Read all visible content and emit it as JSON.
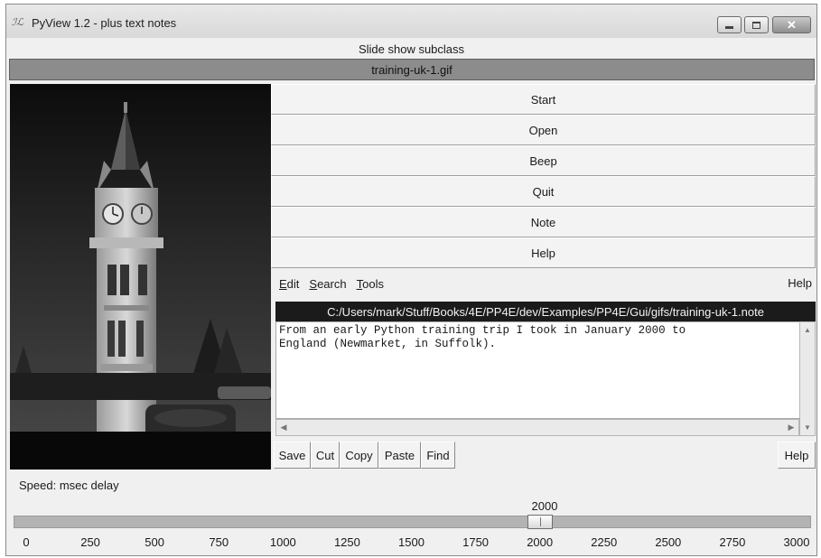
{
  "window": {
    "title": "PyView 1.2 - plus text notes",
    "icon": "tk-feather-icon",
    "controls": {
      "minimize": "minimize-icon",
      "maximize": "maximize-icon",
      "close": "close-icon"
    }
  },
  "header": {
    "subclass_label": "Slide show subclass",
    "image_name": "training-uk-1.gif"
  },
  "photo": {
    "subject": "clock-tower-photo"
  },
  "buttons": [
    {
      "label": "Start"
    },
    {
      "label": "Open"
    },
    {
      "label": "Beep"
    },
    {
      "label": "Quit"
    },
    {
      "label": "Note"
    },
    {
      "label": "Help"
    }
  ],
  "editor": {
    "menu": [
      {
        "label": "Edit",
        "mnemonic": "E",
        "rest": "dit"
      },
      {
        "label": "Search",
        "mnemonic": "S",
        "rest": "earch"
      },
      {
        "label": "Tools",
        "mnemonic": "T",
        "rest": "ools"
      }
    ],
    "menu_help": "Help",
    "file_path": "C:/Users/mark/Stuff/Books/4E/PP4E/dev/Examples/PP4E/Gui/gifs/training-uk-1.note",
    "text": "From an early Python training trip I took in January 2000 to\nEngland (Newmarket, in Suffolk).",
    "toolbar": [
      {
        "label": "Save"
      },
      {
        "label": "Cut"
      },
      {
        "label": "Copy"
      },
      {
        "label": "Paste"
      },
      {
        "label": "Find"
      }
    ],
    "toolbar_help": "Help"
  },
  "speed": {
    "label": "Speed: msec delay",
    "value": 2000,
    "value_text": "2000",
    "min": 0,
    "max": 3000,
    "ticks": [
      "0",
      "250",
      "500",
      "750",
      "1000",
      "1250",
      "1500",
      "1750",
      "2000",
      "2250",
      "2500",
      "2750",
      "3000"
    ]
  }
}
